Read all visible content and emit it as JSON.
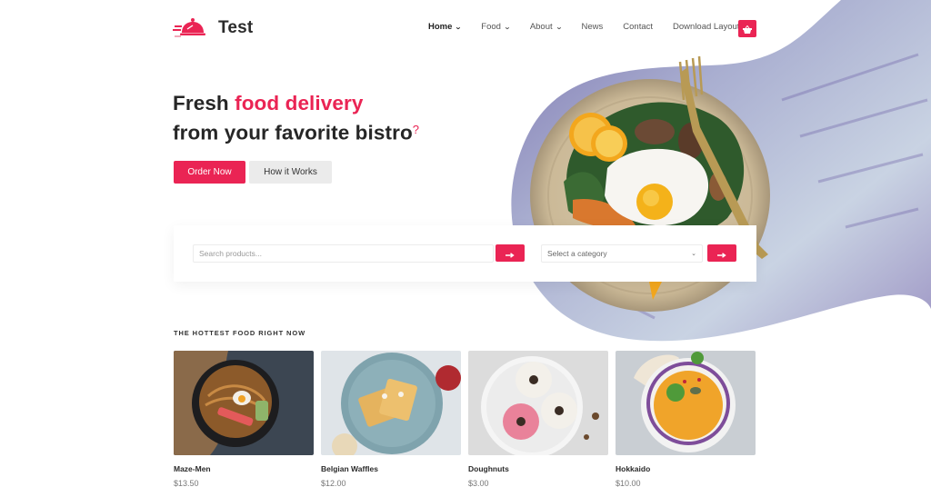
{
  "brand": {
    "name": "Test",
    "accent_color": "#ea2454",
    "icon": "food-cloche-delivery-icon"
  },
  "nav": {
    "items": [
      {
        "label": "Home",
        "active": true,
        "dropdown": true
      },
      {
        "label": "Food",
        "active": false,
        "dropdown": true
      },
      {
        "label": "About",
        "active": false,
        "dropdown": true
      },
      {
        "label": "News",
        "active": false,
        "dropdown": false
      },
      {
        "label": "Contact",
        "active": false,
        "dropdown": false
      },
      {
        "label": "Download Layout",
        "active": false,
        "dropdown": false
      }
    ],
    "cart_icon": "shopping-basket-icon"
  },
  "hero": {
    "headline_part1": "Fresh ",
    "headline_accent": "food delivery",
    "headline_line2": "from your favorite bistro",
    "headline_mark": "?",
    "primary_button": "Order Now",
    "secondary_button": "How it Works",
    "image_alt": "Plate with fried egg, greens, mushrooms and lemon with a gold fork"
  },
  "search": {
    "placeholder": "Search products...",
    "submit_icon": "arrow-right-icon",
    "category_placeholder": "Select a category",
    "category_submit_icon": "arrow-right-icon"
  },
  "hottest": {
    "title": "THE HOTTEST FOOD RIGHT NOW",
    "items": [
      {
        "name": "Maze-Men",
        "price": "$13.50",
        "image": "noodle-bowl"
      },
      {
        "name": "Belgian Waffles",
        "price": "$12.00",
        "image": "waffles-plate"
      },
      {
        "name": "Doughnuts",
        "price": "$3.00",
        "image": "doughnuts-plate"
      },
      {
        "name": "Hokkaido",
        "price": "$10.00",
        "image": "pumpkin-soup"
      }
    ]
  }
}
